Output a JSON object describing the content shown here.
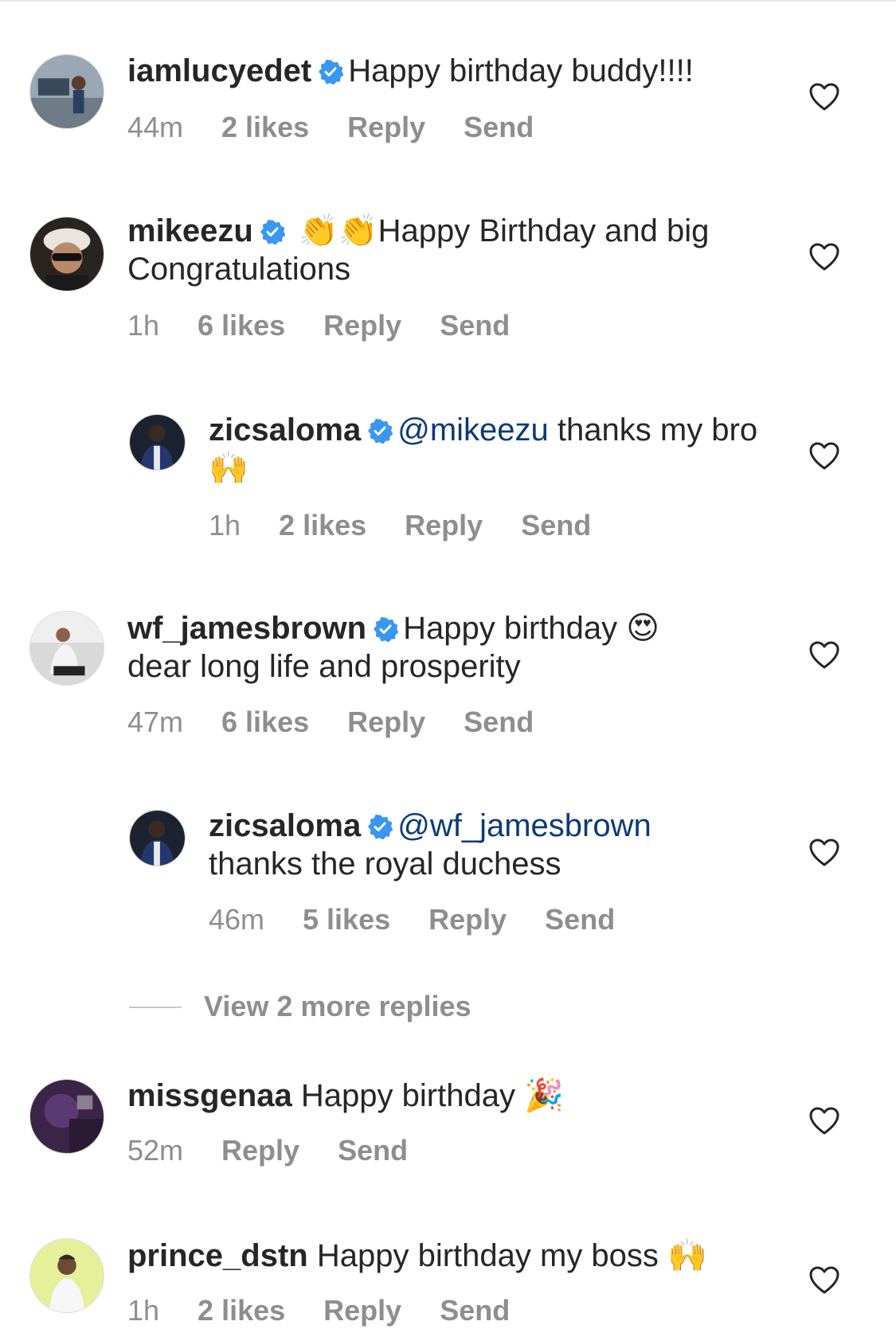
{
  "comments": [
    {
      "username": "iamlucyedet",
      "verified": true,
      "text": "Happy birthday buddy!!!!",
      "time": "44m",
      "likes": "2 likes",
      "reply": "Reply",
      "send": "Send"
    },
    {
      "username": "mikeezu",
      "verified": true,
      "emoji": "👏👏",
      "text": "Happy Birthday and big Congratulations",
      "time": "1h",
      "likes": "6 likes",
      "reply": "Reply",
      "send": "Send"
    },
    {
      "username": "zicsaloma",
      "verified": true,
      "mention": "@mikeezu",
      "text": "thanks my bro",
      "emoji": "🙌",
      "time": "1h",
      "likes": "2 likes",
      "reply": "Reply",
      "send": "Send"
    },
    {
      "username": "wf_jamesbrown",
      "verified": true,
      "text": "Happy birthday",
      "emoji": "😍",
      "text2": "dear long life and prosperity",
      "time": "47m",
      "likes": "6 likes",
      "reply": "Reply",
      "send": "Send"
    },
    {
      "username": "zicsaloma",
      "verified": true,
      "mention": "@wf_jamesbrown",
      "text": "thanks the royal duchess",
      "time": "46m",
      "likes": "5 likes",
      "reply": "Reply",
      "send": "Send"
    },
    {
      "username": "missgenaa",
      "verified": false,
      "text": "Happy birthday",
      "emoji": "🎉",
      "time": "52m",
      "reply": "Reply",
      "send": "Send"
    },
    {
      "username": "prince_dstn",
      "verified": false,
      "text": "Happy birthday my boss",
      "emoji": "🙌",
      "time": "1h",
      "likes": "2 likes",
      "reply": "Reply",
      "send": "Send"
    }
  ],
  "view_more_replies": "View 2 more replies",
  "icons": {
    "verified": "verified-badge-icon",
    "like": "heart-icon"
  },
  "colors": {
    "verified": "#3897f0",
    "meta": "#8e8e8e",
    "mention": "#0b3a7a"
  }
}
